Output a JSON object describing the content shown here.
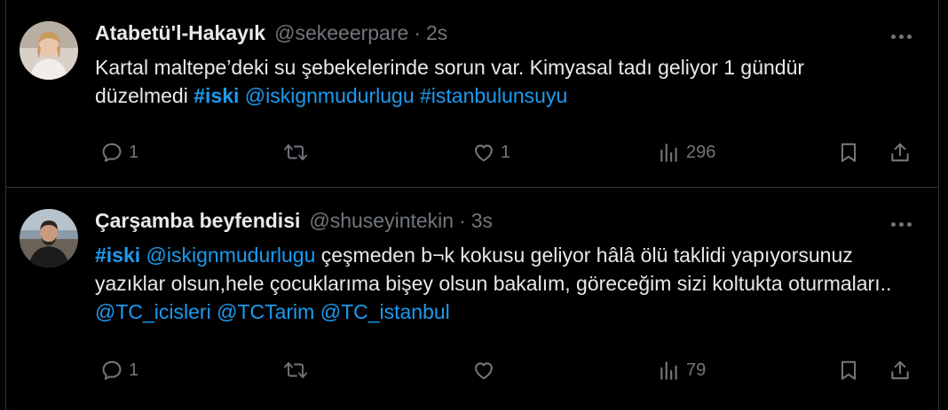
{
  "tweets": [
    {
      "author": "Atabetü'l-Hakayık",
      "handle": "@sekeeerpare",
      "separator": "·",
      "time": "2s",
      "text": [
        {
          "t": "Kartal maltepe’deki su şebekelerinde sorun var. Kimyasal tadı geliyor 1 gündür düzelmedi ",
          "k": "plain"
        },
        {
          "t": "#iski",
          "k": "tag"
        },
        {
          "t": " ",
          "k": "plain"
        },
        {
          "t": "@iskignmudurlugu",
          "k": "link"
        },
        {
          "t": " ",
          "k": "plain"
        },
        {
          "t": "#istanbulunsuyu",
          "k": "link"
        }
      ],
      "replies": "1",
      "retweets": "",
      "likes": "1",
      "views": "296"
    },
    {
      "author": "Çarşamba beyfendisi",
      "handle": "@shuseyintekin",
      "separator": "·",
      "time": "3s",
      "text": [
        {
          "t": "#iski",
          "k": "tag"
        },
        {
          "t": " ",
          "k": "plain"
        },
        {
          "t": "@iskignmudurlugu",
          "k": "link"
        },
        {
          "t": " çeşmeden b¬k kokusu geliyor hâlâ ölü taklidi yapıyorsunuz yazıklar olsun,hele çocuklarıma bişey olsun bakalım, göreceğim sizi koltukta oturmaları.. ",
          "k": "plain"
        },
        {
          "t": "@TC_icisleri",
          "k": "link"
        },
        {
          "t": " ",
          "k": "plain"
        },
        {
          "t": "@TCTarim",
          "k": "link"
        },
        {
          "t": " ",
          "k": "plain"
        },
        {
          "t": "@TC_istanbul",
          "k": "link"
        }
      ],
      "replies": "1",
      "retweets": "",
      "likes": "",
      "views": "79"
    }
  ],
  "icons": {
    "reply": "reply-icon",
    "retweet": "retweet-icon",
    "like": "like-icon",
    "views": "views-icon",
    "bookmark": "bookmark-icon",
    "share": "share-icon",
    "more": "more-icon"
  },
  "colors": {
    "background": "#000000",
    "text": "#e7e9ea",
    "muted": "#71767b",
    "accent": "#1d9bf0",
    "border": "#2f3336"
  }
}
